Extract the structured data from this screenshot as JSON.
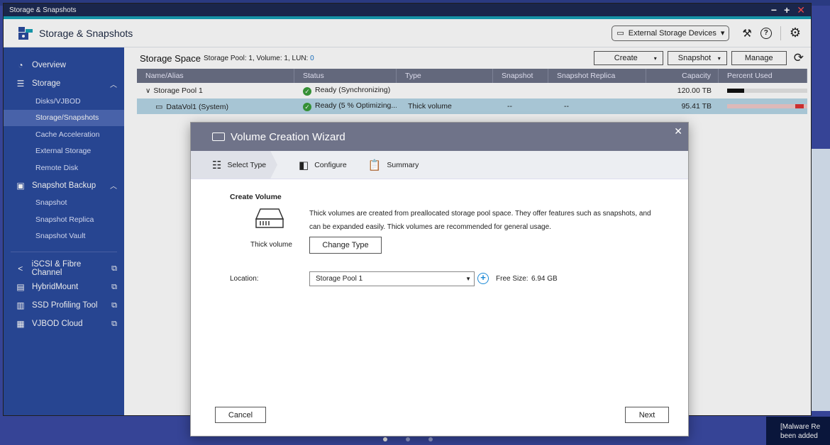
{
  "window": {
    "title": "Storage & Snapshots",
    "app_title": "Storage & Snapshots",
    "ext_devices": "External Storage Devices"
  },
  "sidebar": {
    "overview": "Overview",
    "storage": "Storage",
    "storage_items": [
      "Disks/VJBOD",
      "Storage/Snapshots",
      "Cache Acceleration",
      "External Storage",
      "Remote Disk"
    ],
    "snapshot_backup": "Snapshot Backup",
    "snapshot_items": [
      "Snapshot",
      "Snapshot Replica",
      "Snapshot Vault"
    ],
    "links": [
      "iSCSI & Fibre Channel",
      "HybridMount",
      "SSD Profiling Tool",
      "VJBOD Cloud"
    ]
  },
  "main": {
    "title": "Storage Space",
    "subtitle_prefix": "Storage Pool: 1, Volume: 1, LUN:",
    "lun_count": "0",
    "buttons": {
      "create": "Create",
      "snapshot": "Snapshot",
      "manage": "Manage"
    },
    "columns": [
      "Name/Alias",
      "Status",
      "Type",
      "Snapshot",
      "Snapshot Replica",
      "Capacity",
      "Percent Used"
    ],
    "rows": [
      {
        "name": "Storage Pool 1",
        "status": "Ready (Synchronizing)",
        "type": "",
        "snapshot": "",
        "replica": "",
        "capacity": "120.00 TB",
        "percent_used": 0.2
      },
      {
        "name": "DataVol1 (System)",
        "status": "Ready (5 % Optimizing...)",
        "type": "Thick volume",
        "snapshot": "--",
        "replica": "--",
        "capacity": "95.41 TB",
        "percent_used": 0.8
      }
    ]
  },
  "dialog": {
    "title": "Volume Creation Wizard",
    "steps": [
      "Select Type",
      "Configure",
      "Summary"
    ],
    "section_title": "Create Volume",
    "volume_type_label": "Thick volume",
    "description": "Thick volumes are created from preallocated storage pool space. They offer features such as snapshots, and can be expanded easily. Thick volumes are recommended for general usage.",
    "change_type": "Change Type",
    "location_label": "Location:",
    "location_value": "Storage Pool 1",
    "free_size_label": "Free Size:",
    "free_size_value": "6.94 GB",
    "cancel": "Cancel",
    "next": "Next"
  },
  "desktop": {
    "notification": "[Malware Re been added"
  },
  "colors": {
    "sidebar_bg": "#2b4b9e",
    "header_accent": "#17a0b5",
    "table_header": "#6c7187",
    "selected_row": "#b6d6e6",
    "ok_green": "#3a9d3a"
  }
}
